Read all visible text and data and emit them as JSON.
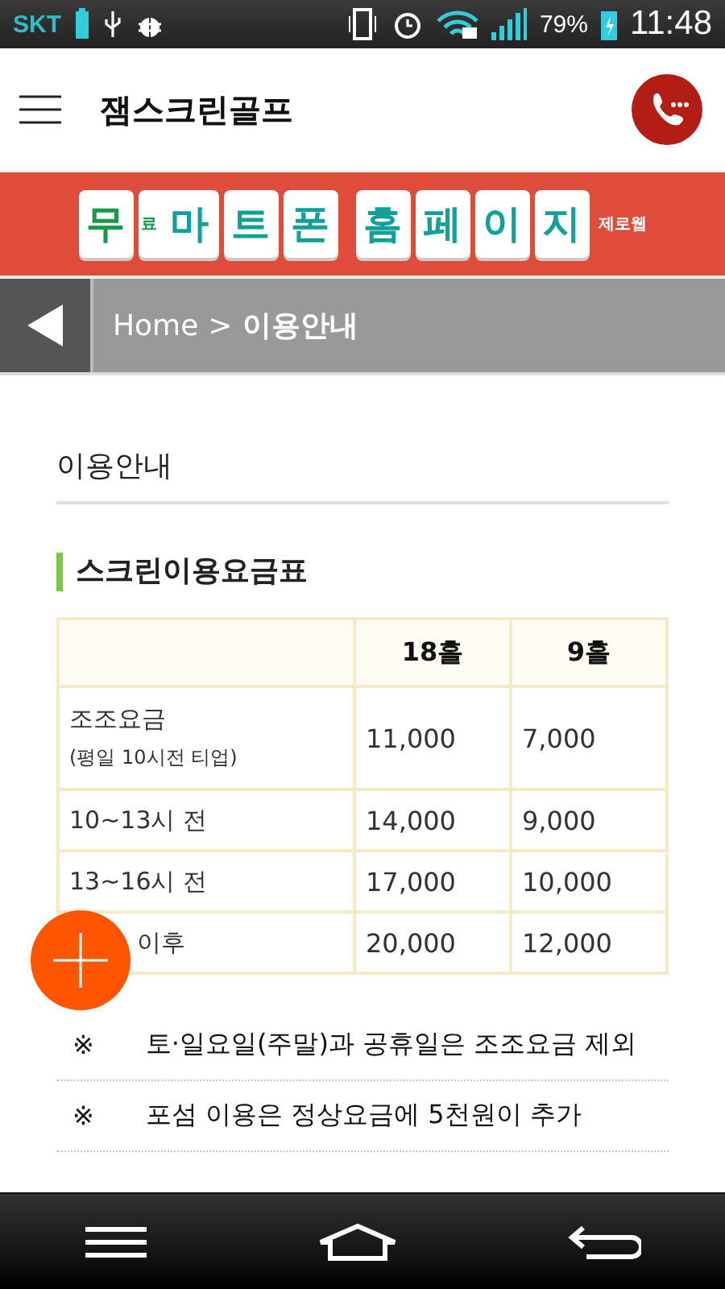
{
  "status_bar": {
    "carrier": "SKT",
    "battery": "79%",
    "time": "11:48"
  },
  "app_bar": {
    "title": "잼스크린골프"
  },
  "banner": {
    "tiles": [
      {
        "text": "무",
        "kind": "square"
      },
      {
        "text": "료",
        "kind": "mini"
      },
      {
        "text": "마",
        "kind": "hex"
      },
      {
        "text": "트",
        "kind": "square"
      },
      {
        "text": "폰",
        "kind": "square"
      },
      {
        "text": "홈",
        "kind": "gap"
      },
      {
        "text": "페",
        "kind": "square"
      },
      {
        "text": "이",
        "kind": "square"
      },
      {
        "text": "지",
        "kind": "square"
      }
    ],
    "brand": "제로웹"
  },
  "breadcrumb": {
    "home": "Home",
    "separator": ">",
    "current": "이용안내"
  },
  "page_title": "이용안내",
  "section_title": "스크린이용요금표",
  "table": {
    "columns": [
      "18홀",
      "9홀"
    ],
    "rows": [
      {
        "label": "조조요금",
        "note": "(평일 10시전 티업)",
        "values": [
          "11,000",
          "7,000"
        ],
        "covered": false
      },
      {
        "label": "10~13시 전",
        "values": [
          "14,000",
          "9,000"
        ],
        "covered": false
      },
      {
        "label": "13~16시 전",
        "values": [
          "17,000",
          "10,000"
        ],
        "covered": false
      },
      {
        "label": "이후",
        "values": [
          "20,000",
          "12,000"
        ],
        "covered": true
      }
    ]
  },
  "notes": [
    {
      "mark": "※",
      "text": "토·일요일(주말)과 공휴일은 조조요금 제외"
    },
    {
      "mark": "※",
      "text": "포섬 이용은 정상요금에 5천원이 추가"
    }
  ]
}
